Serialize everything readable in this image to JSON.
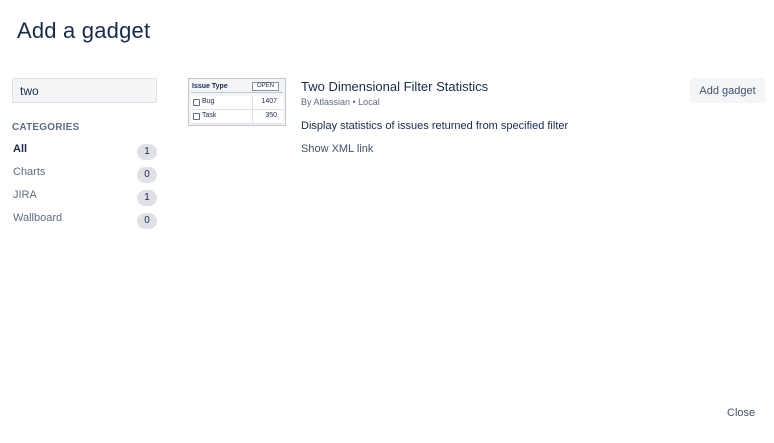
{
  "dialog": {
    "title": "Add a gadget",
    "close_label": "Close"
  },
  "search": {
    "value": "two",
    "placeholder": ""
  },
  "categories": {
    "heading": "CATEGORIES",
    "items": [
      {
        "label": "All",
        "count": "1",
        "active": true
      },
      {
        "label": "Charts",
        "count": "0",
        "active": false
      },
      {
        "label": "JIRA",
        "count": "1",
        "active": false
      },
      {
        "label": "Wallboard",
        "count": "0",
        "active": false
      }
    ]
  },
  "gadget": {
    "title": "Two Dimensional Filter Statistics",
    "meta": "By Atlassian • Local",
    "description": "Display statistics of issues returned from specified filter",
    "xml_link": "Show XML link",
    "add_label": "Add gadget",
    "thumbnail": {
      "header": "Issue Type",
      "badge": "OPEN",
      "rows": [
        {
          "name": "Bug",
          "value": "1407"
        },
        {
          "name": "Task",
          "value": "350"
        }
      ]
    }
  }
}
